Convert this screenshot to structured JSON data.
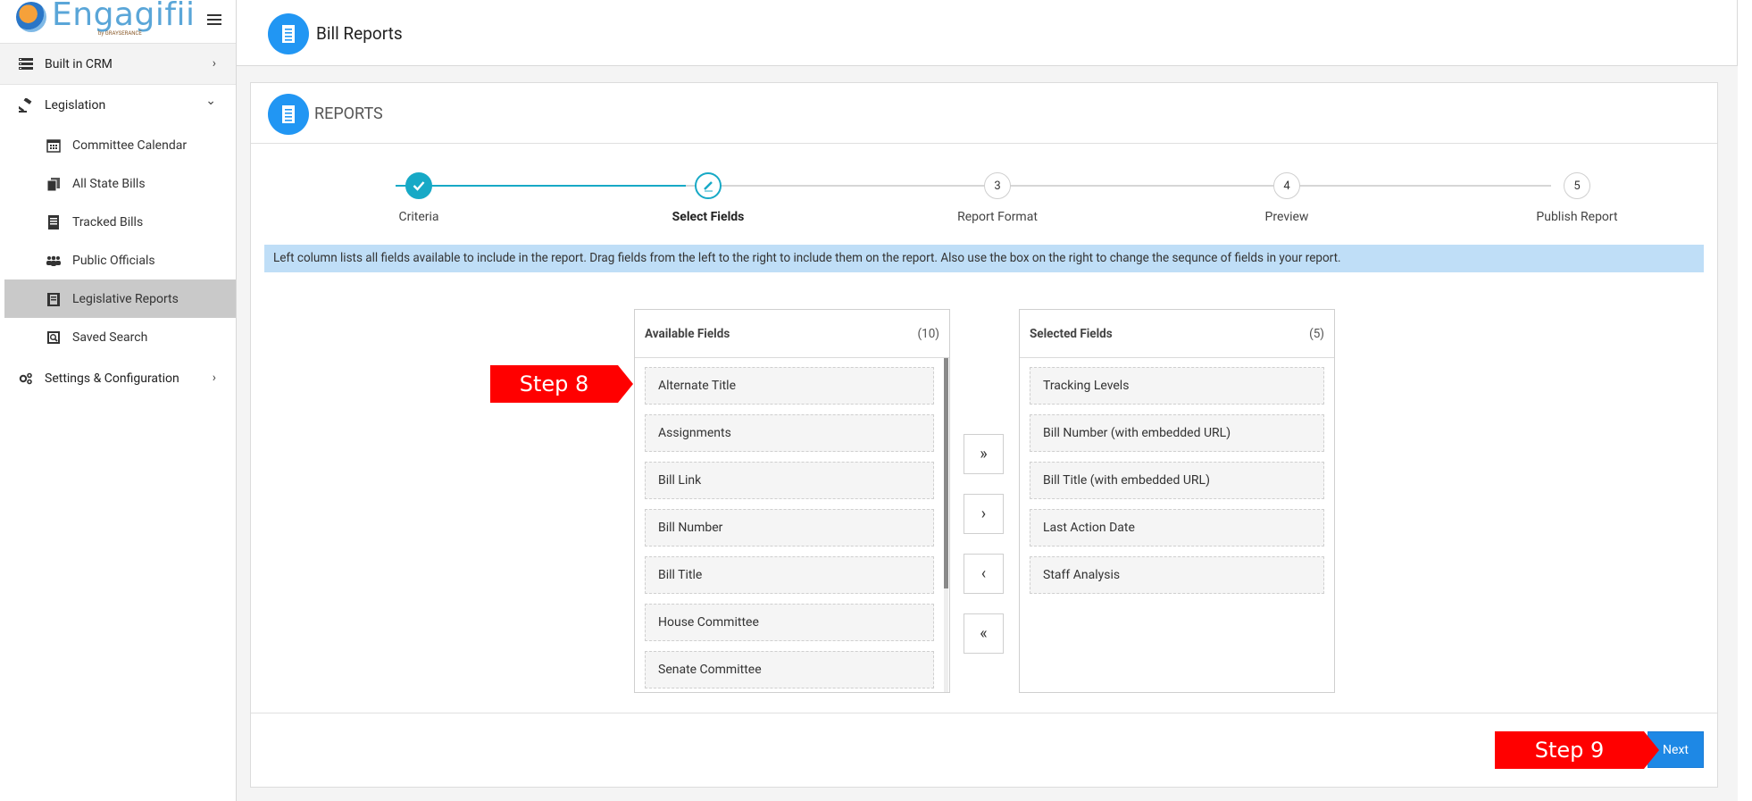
{
  "app": {
    "logo_text": "Engagifii",
    "logo_sub": "by GRAYSERANCE"
  },
  "sidebar": {
    "sections": [
      {
        "label": "Built in CRM",
        "icon": "database-icon",
        "chevron": "›"
      },
      {
        "label": "Legislation",
        "icon": "gavel-icon",
        "chevron": "⌄"
      },
      {
        "label": "Settings & Configuration",
        "icon": "gears-icon",
        "chevron": "›"
      }
    ],
    "items": [
      {
        "label": "Committee Calendar",
        "icon": "calendar-icon"
      },
      {
        "label": "All State Bills",
        "icon": "documents-icon"
      },
      {
        "label": "Tracked Bills",
        "icon": "tracked-document-icon"
      },
      {
        "label": "Public Officials",
        "icon": "people-icon"
      },
      {
        "label": "Legislative Reports",
        "icon": "report-icon"
      },
      {
        "label": "Saved Search",
        "icon": "saved-search-icon"
      }
    ]
  },
  "header": {
    "title": "Bill Reports"
  },
  "card": {
    "title": "REPORTS"
  },
  "stepper": {
    "steps": [
      {
        "num": "✓",
        "label": "Criteria",
        "state": "done"
      },
      {
        "num": "✎",
        "label": "Select Fields",
        "state": "current"
      },
      {
        "num": "3",
        "label": "Report Format",
        "state": "pending"
      },
      {
        "num": "4",
        "label": "Preview",
        "state": "pending"
      },
      {
        "num": "5",
        "label": "Publish Report",
        "state": "pending"
      }
    ]
  },
  "info_text": "Left column lists all fields available to include in the report. Drag fields from the left to the right to include them on the report. Also use the box on the right to change the sequnce of fields in your report.",
  "available": {
    "title": "Available Fields",
    "count": "(10)",
    "fields": [
      "Alternate Title",
      "Assignments",
      "Bill Link",
      "Bill Number",
      "Bill Title",
      "House Committee",
      "Senate Committee"
    ]
  },
  "selected": {
    "title": "Selected Fields",
    "count": "(5)",
    "fields": [
      "Tracking Levels",
      "Bill Number (with embedded URL)",
      "Bill Title (with embedded URL)",
      "Last Action Date",
      "Staff Analysis"
    ]
  },
  "movers": {
    "add_all": "»",
    "add_one": "›",
    "remove_one": "‹",
    "remove_all": "«"
  },
  "footer": {
    "next_label": "Next"
  },
  "annotations": {
    "step8": "Step 8",
    "step9": "Step 9"
  },
  "colors": {
    "accent": "#2196f3",
    "stepper": "#17a9c6",
    "info_bg": "#bfdef7",
    "callout": "#ff0000"
  }
}
